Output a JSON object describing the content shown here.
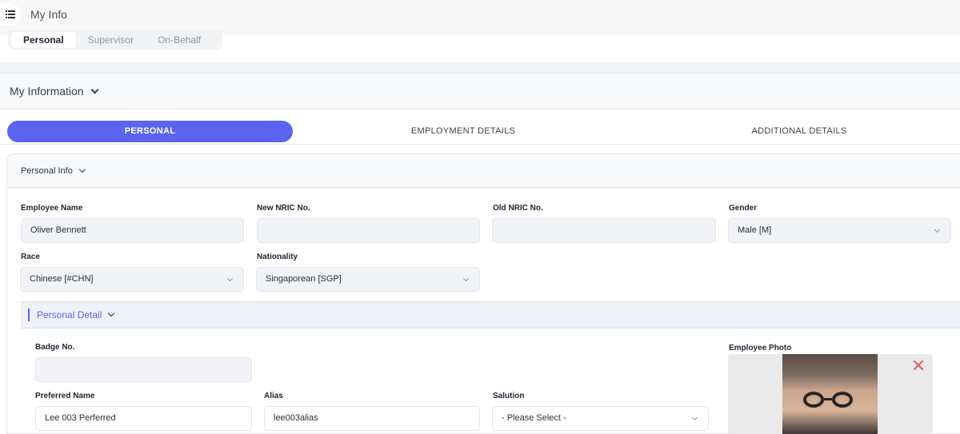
{
  "app": {
    "title": "My Info"
  },
  "subtabs": [
    {
      "label": "Personal"
    },
    {
      "label": "Supervisor"
    },
    {
      "label": "On-Behalf"
    }
  ],
  "section": {
    "title": "My Information"
  },
  "tabs": [
    {
      "label": "PERSONAL"
    },
    {
      "label": "EMPLOYMENT DETAILS"
    },
    {
      "label": "ADDITIONAL DETAILS"
    }
  ],
  "personal_info": {
    "title": "Personal Info",
    "fields": {
      "employee_name": {
        "label": "Employee Name",
        "value": "Oliver Bennett"
      },
      "new_nric": {
        "label": "New NRIC No.",
        "value": ""
      },
      "old_nric": {
        "label": "Old NRIC No.",
        "value": ""
      },
      "gender": {
        "label": "Gender",
        "value": "Male [M]"
      },
      "race": {
        "label": "Race",
        "value": "Chinese [#CHN]"
      },
      "nationality": {
        "label": "Nationality",
        "value": "Singaporean [SGP]"
      }
    }
  },
  "personal_detail": {
    "title": "Personal Detail",
    "fields": {
      "badge_no": {
        "label": "Badge No.",
        "value": ""
      },
      "preferred_name": {
        "label": "Preferred Name",
        "value": "Lee 003 Perferred"
      },
      "alias": {
        "label": "Alias",
        "value": "lee003alias"
      },
      "salution": {
        "label": "Salution",
        "value": "- Please Select -"
      }
    },
    "photo_label": "Employee Photo"
  },
  "colors": {
    "accent": "#5b64ef",
    "close": "#e25a5a"
  }
}
